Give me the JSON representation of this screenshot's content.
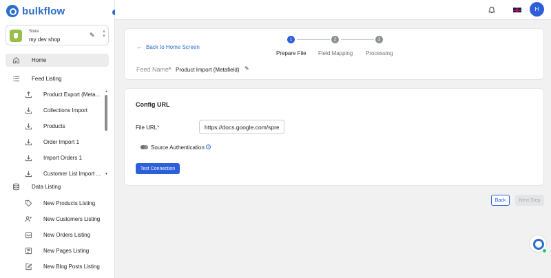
{
  "app": {
    "name": "bulkflow"
  },
  "store": {
    "label": "Store",
    "name": "my dev shop"
  },
  "sidebar": {
    "items": [
      {
        "label": "Home",
        "icon": "home-icon"
      },
      {
        "label": "Feed Listing",
        "icon": "list-icon"
      },
      {
        "label": "Product Export (Meta...",
        "icon": "upload-icon"
      },
      {
        "label": "Collections Import",
        "icon": "download-icon"
      },
      {
        "label": "Products",
        "icon": "download-icon"
      },
      {
        "label": "Order Import 1",
        "icon": "download-icon"
      },
      {
        "label": "Import Orders 1",
        "icon": "download-icon"
      },
      {
        "label": "Customer List Import ...",
        "icon": "download-icon"
      },
      {
        "label": "Data Listing",
        "icon": "database-icon"
      },
      {
        "label": "New Products Listing",
        "icon": "tag-icon"
      },
      {
        "label": "New Customers Listing",
        "icon": "user-plus-icon"
      },
      {
        "label": "New Orders Listing",
        "icon": "order-icon"
      },
      {
        "label": "New Pages Listing",
        "icon": "pages-icon"
      },
      {
        "label": "New Blog Posts Listing",
        "icon": "edit-icon"
      }
    ]
  },
  "header": {
    "avatar_initial": "H"
  },
  "stepper": {
    "back_link": "Back to Home Screen",
    "steps": [
      {
        "number": "1",
        "label": "Prepare File",
        "state": "active"
      },
      {
        "number": "2",
        "label": "Field Mapping",
        "state": "pending"
      },
      {
        "number": "3",
        "label": "Processing",
        "state": "pending"
      }
    ]
  },
  "feed": {
    "label": "Feed Name",
    "required_mark": "*",
    "value": "Product Import (Metafield)"
  },
  "config": {
    "title": "Config URL",
    "file_url_label": "File URL",
    "required_mark": "*",
    "file_url_value": "https://docs.google.com/spreadsheets",
    "source_auth_label": "Source Authentication",
    "test_button": "Test Connection"
  },
  "footer": {
    "back_button": "Back",
    "next_button": "Next Step"
  },
  "colors": {
    "primary": "#2c5fd9",
    "link": "#2c6ecb",
    "shopify": "#95bf47"
  }
}
